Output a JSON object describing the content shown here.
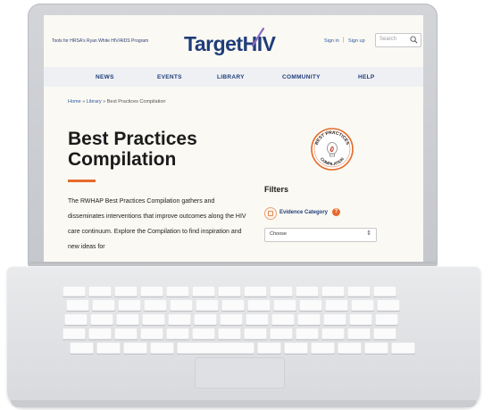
{
  "header": {
    "tools_link": "Tools for HRSA's Ryan White HIV/AIDS Program",
    "logo_target": "Target",
    "logo_hiv": "HIV",
    "sign_in": "Sign in",
    "separator": "|",
    "sign_up": "Sign up",
    "search_placeholder": "Search"
  },
  "nav": [
    "NEWS",
    "EVENTS",
    "LIBRARY",
    "COMMUNITY",
    "HELP"
  ],
  "breadcrumb": {
    "home": "Home",
    "sep": "»",
    "library": "Library",
    "current": "Best Practices Compilation"
  },
  "page": {
    "title": "Best Practices Compilation",
    "intro": "The RWHAP Best Practices Compilation gathers and disseminates interventions that improve outcomes along the HIV care continuum. Explore the Compilation to find inspiration and new ideas for",
    "badge_text_top": "BEST PRACTICES",
    "badge_text_bottom": "COMPILATION"
  },
  "filters": {
    "title": "Filters",
    "category_label": "Evidence Category",
    "help": "?",
    "select_value": "Choose",
    "select_arrow": "⇕"
  },
  "colors": {
    "brand_navy": "#1f3d7a",
    "accent_orange": "#e46b2c",
    "swoosh_purple": "#8a6bc2"
  }
}
